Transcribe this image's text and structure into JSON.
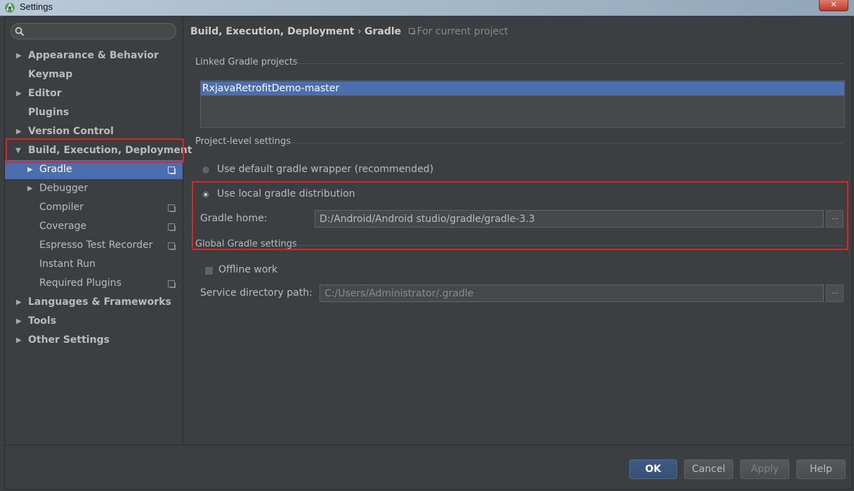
{
  "window": {
    "title": "Settings",
    "close_label": "✕"
  },
  "search": {
    "placeholder": ""
  },
  "sidebar": {
    "items": [
      {
        "label": "Appearance & Behavior"
      },
      {
        "label": "Keymap"
      },
      {
        "label": "Editor"
      },
      {
        "label": "Plugins"
      },
      {
        "label": "Version Control"
      },
      {
        "label": "Build, Execution, Deployment"
      },
      {
        "label": "Gradle"
      },
      {
        "label": "Debugger"
      },
      {
        "label": "Compiler"
      },
      {
        "label": "Coverage"
      },
      {
        "label": "Espresso Test Recorder"
      },
      {
        "label": "Instant Run"
      },
      {
        "label": "Required Plugins"
      },
      {
        "label": "Languages & Frameworks"
      },
      {
        "label": "Tools"
      },
      {
        "label": "Other Settings"
      }
    ]
  },
  "breadcrumb": {
    "parent": "Build, Execution, Deployment",
    "separator": "›",
    "current": "Gradle",
    "scope": "For current project"
  },
  "linked": {
    "heading": "Linked Gradle projects",
    "projects": [
      "RxjavaRetrofitDemo-master"
    ]
  },
  "project_settings": {
    "heading": "Project-level settings",
    "option_default": "Use default gradle wrapper (recommended)",
    "option_local": "Use local gradle distribution",
    "selected_option": "Use local gradle distribution",
    "gradle_home_label": "Gradle home:",
    "gradle_home_value": "D:/Android/Android studio/gradle/gradle-3.3",
    "browse_label": "..."
  },
  "global_settings": {
    "heading": "Global Gradle settings",
    "offline_label": "Offline work",
    "offline_checked": false,
    "service_dir_label": "Service directory path:",
    "service_dir_value": "C:/Users/Administrator/.gradle",
    "browse_label": "..."
  },
  "footer": {
    "ok": "OK",
    "cancel": "Cancel",
    "apply": "Apply",
    "help": "Help"
  },
  "colors": {
    "selection": "#4b6eaf",
    "highlight_box": "#e32222",
    "background": "#3c3f41"
  }
}
